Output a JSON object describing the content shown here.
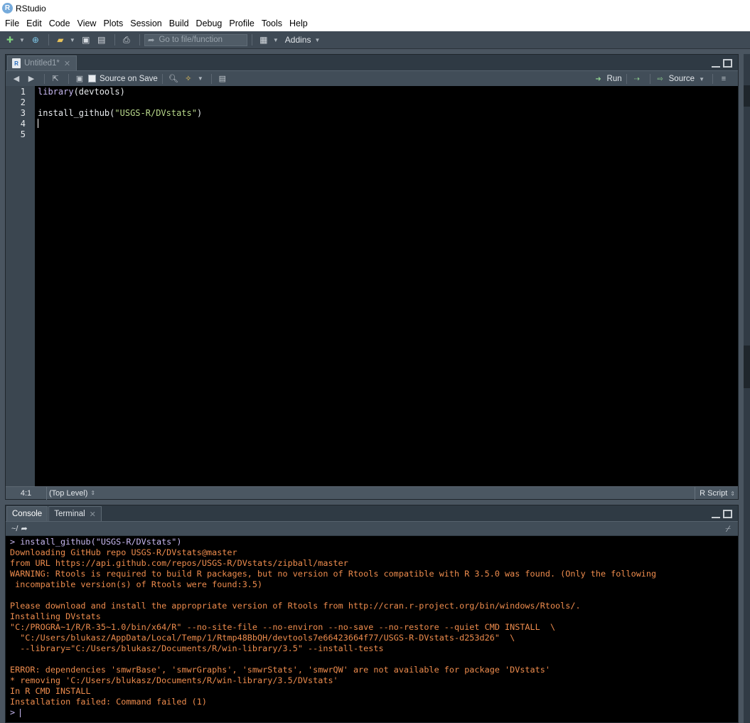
{
  "window": {
    "title": "RStudio",
    "app_icon": "R"
  },
  "menu": [
    "File",
    "Edit",
    "Code",
    "View",
    "Plots",
    "Session",
    "Build",
    "Debug",
    "Profile",
    "Tools",
    "Help"
  ],
  "toolbar": {
    "goto_placeholder": "Go to file/function",
    "addins_label": "Addins"
  },
  "source": {
    "tab_label": "Untitled1*",
    "source_on_save_label": "Source on Save",
    "run_label": "Run",
    "source_label": "Source",
    "line_numbers": [
      "1",
      "2",
      "3",
      "4",
      "5"
    ],
    "code": {
      "line1_fn": "library",
      "line1_rest": "(devtools)",
      "line3_fn": "install_github",
      "line3_open": "(",
      "line3_str": "\"USGS-R/DVstats\"",
      "line3_close": ")"
    },
    "status": {
      "cursor_pos": "4:1",
      "scope": "(Top Level)",
      "file_type": "R Script"
    }
  },
  "console": {
    "tabs": [
      "Console",
      "Terminal"
    ],
    "path": "~/",
    "lines": [
      {
        "kind": "cmd",
        "text": "> install_github(\"USGS-R/DVstats\")"
      },
      {
        "kind": "out",
        "text": "Downloading GitHub repo USGS-R/DVstats@master"
      },
      {
        "kind": "out",
        "text": "from URL https://api.github.com/repos/USGS-R/DVstats/zipball/master"
      },
      {
        "kind": "out",
        "text": "WARNING: Rtools is required to build R packages, but no version of Rtools compatible with R 3.5.0 was found. (Only the following"
      },
      {
        "kind": "out",
        "text": " incompatible version(s) of Rtools were found:3.5)"
      },
      {
        "kind": "blank",
        "text": ""
      },
      {
        "kind": "out",
        "text": "Please download and install the appropriate version of Rtools from http://cran.r-project.org/bin/windows/Rtools/."
      },
      {
        "kind": "out",
        "text": "Installing DVstats"
      },
      {
        "kind": "out",
        "text": "\"C:/PROGRA~1/R/R-35~1.0/bin/x64/R\" --no-site-file --no-environ --no-save --no-restore --quiet CMD INSTALL  \\"
      },
      {
        "kind": "out",
        "text": "  \"C:/Users/blukasz/AppData/Local/Temp/1/Rtmp48BbQH/devtools7e66423664f77/USGS-R-DVstats-d253d26\"  \\"
      },
      {
        "kind": "out",
        "text": "  --library=\"C:/Users/blukasz/Documents/R/win-library/3.5\" --install-tests"
      },
      {
        "kind": "blank",
        "text": ""
      },
      {
        "kind": "out",
        "text": "ERROR: dependencies 'smwrBase', 'smwrGraphs', 'smwrStats', 'smwrQW' are not available for package 'DVstats'"
      },
      {
        "kind": "out",
        "text": "* removing 'C:/Users/blukasz/Documents/R/win-library/3.5/DVstats'"
      },
      {
        "kind": "out",
        "text": "In R CMD INSTALL"
      },
      {
        "kind": "out",
        "text": "Installation failed: Command failed (1)"
      },
      {
        "kind": "prompt",
        "text": "> "
      }
    ]
  },
  "colors": {
    "console_output": "#ee8c4d",
    "console_command": "#c6b7f0",
    "editor_bg": "#000000",
    "chrome_bg": "#414d58"
  }
}
